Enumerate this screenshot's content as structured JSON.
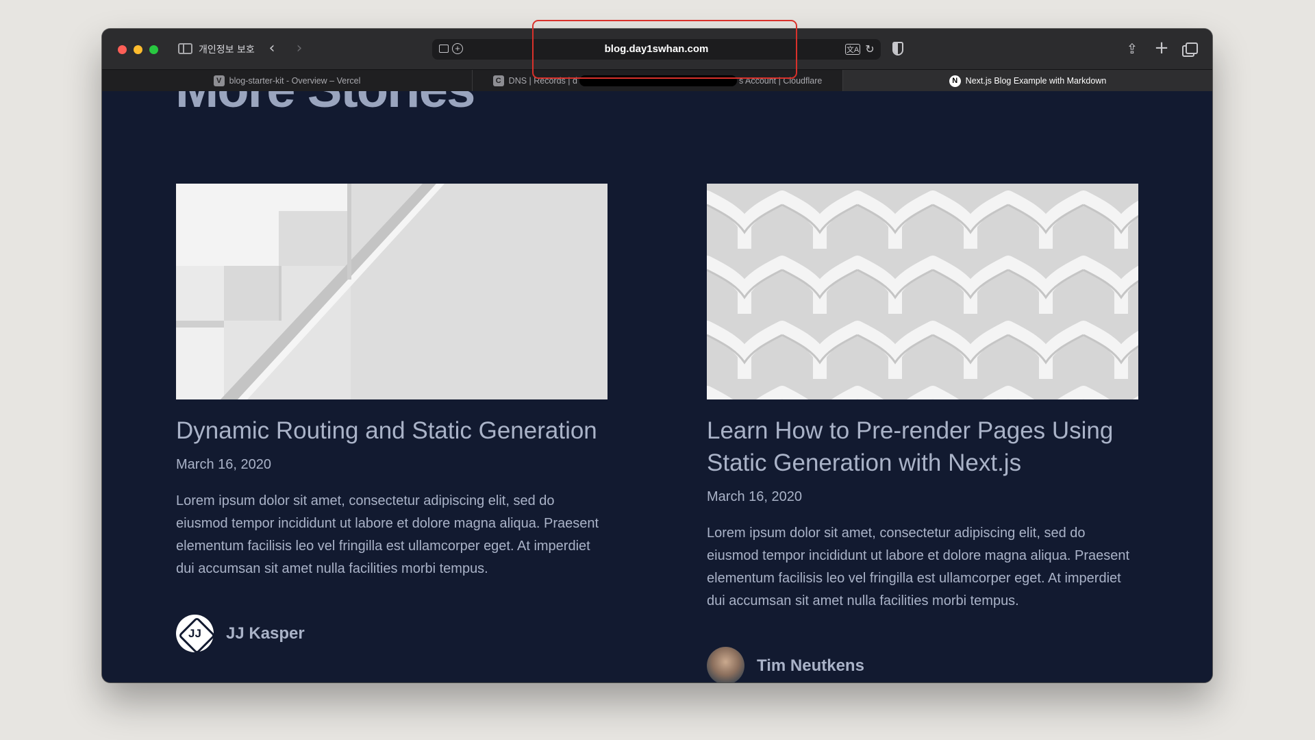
{
  "browser": {
    "privacy_label": "개인정보 보호",
    "address": {
      "url": "blog.day1swhan.com"
    },
    "tabs": [
      {
        "favicon": "V",
        "title": "blog-starter-kit - Overview – Vercel"
      },
      {
        "favicon": "C",
        "title_start": "DNS | Records | d",
        "title_end": "s Account | Cloudflare"
      },
      {
        "favicon": "N",
        "title": "Next.js Blog Example with Markdown"
      }
    ],
    "icons": {
      "back": "chevron-left-icon",
      "forward": "chevron-right-icon",
      "share": "share-icon",
      "new_tab": "plus-icon",
      "tab_overview": "tabs-icon",
      "reload": "reload-icon",
      "translate": "translate-icon",
      "privacy": "shield-icon"
    },
    "glyphs": {
      "back": "‹",
      "forward": "›",
      "reader_plus": "+",
      "translate": "文A",
      "reload": "↻",
      "share": "⇪",
      "new_tab": "+"
    }
  },
  "page": {
    "section_heading": "More Stories",
    "posts": [
      {
        "title": "Dynamic Routing and Static Generation",
        "date": "March 16, 2020",
        "excerpt": "Lorem ipsum dolor sit amet, consectetur adipiscing elit, sed do eiusmod tempor incididunt ut labore et dolore magna aliqua. Praesent elementum facilisis leo vel fringilla est ullamcorper eget. At imperdiet dui accumsan sit amet nulla facilities morbi tempus.",
        "author": {
          "name": "JJ Kasper",
          "avatar_text": "JJ"
        }
      },
      {
        "title": "Learn How to Pre-render Pages Using Static Generation with Next.js",
        "date": "March 16, 2020",
        "excerpt": "Lorem ipsum dolor sit amet, consectetur adipiscing elit, sed do eiusmod tempor incididunt ut labore et dolore magna aliqua. Praesent elementum facilisis leo vel fringilla est ullamcorper eget. At imperdiet dui accumsan sit amet nulla facilities morbi tempus.",
        "author": {
          "name": "Tim Neutkens"
        }
      }
    ]
  },
  "colors": {
    "page_background": "#121a30",
    "text": "#aab3c8",
    "annotation": "#d9312b"
  }
}
